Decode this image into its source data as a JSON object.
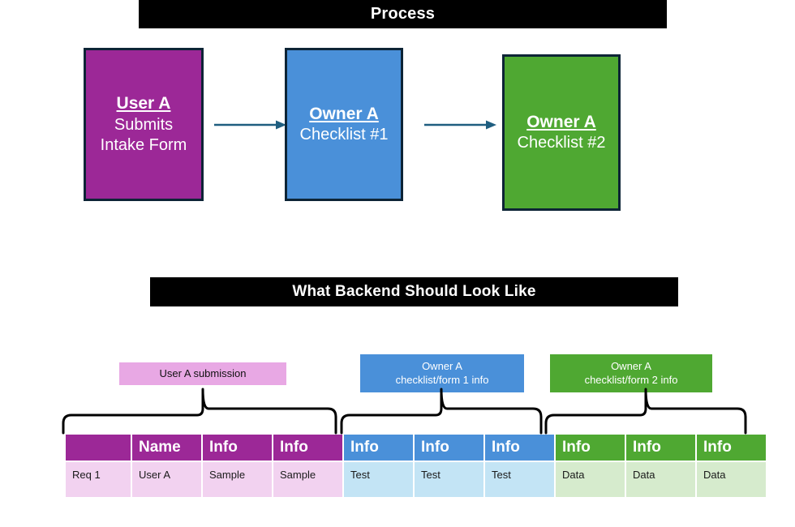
{
  "sections": {
    "process": {
      "banner_title": "Process",
      "steps": [
        {
          "title": "User A",
          "line1": "Submits",
          "line2": "Intake Form",
          "color": "#9C2897"
        },
        {
          "title": "Owner A",
          "line1": "Checklist #1",
          "line2": "",
          "color": "#4A90D9"
        },
        {
          "title": "Owner A",
          "line1": "Checklist #2",
          "line2": "",
          "color": "#4FA832"
        }
      ],
      "arrow_color": "#1F5E80"
    },
    "backend": {
      "banner_title": "What Backend Should Look Like",
      "callouts": [
        {
          "line1": "User A submission",
          "line2": "",
          "color": "#E8A8E4"
        },
        {
          "line1": "Owner A",
          "line2": "checklist/form 1 info",
          "color": "#4A90D9"
        },
        {
          "line1": "Owner A",
          "line2": "checklist/form 2 info",
          "color": "#4FA832"
        }
      ],
      "table": {
        "headers": [
          "",
          "Name",
          "Info",
          "Info",
          "Info",
          "Info",
          "Info",
          "Info",
          "Info"
        ],
        "rows": [
          [
            "Req 1",
            "User A",
            "Sample",
            "Sample",
            "Test",
            "Test",
            "Test",
            "Data",
            "Data",
            "Data"
          ]
        ],
        "group_colors": {
          "magenta": "#9C2897",
          "blue": "#4A90D9",
          "green": "#4FA832",
          "magenta_tint": "#F2D2F0",
          "blue_tint": "#C3E4F5",
          "green_tint": "#D6EBCD"
        }
      }
    }
  }
}
